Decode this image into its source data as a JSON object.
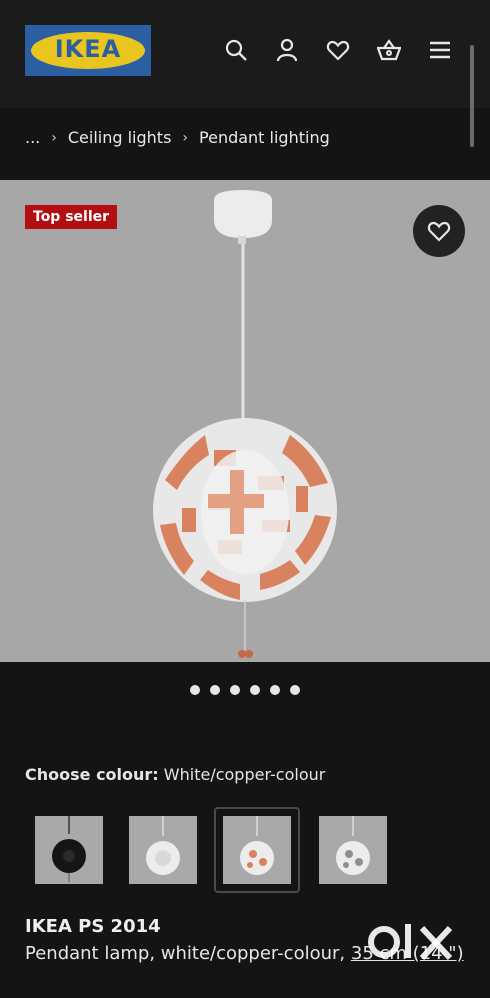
{
  "header": {
    "logo_text": "IKEA",
    "icons": [
      "search-icon",
      "user-icon",
      "heart-icon",
      "basket-icon",
      "menu-icon"
    ]
  },
  "breadcrumb": [
    "...",
    "Ceiling lights",
    "Pendant lighting"
  ],
  "gallery": {
    "badge": "Top seller",
    "dots_count": 6
  },
  "colour": {
    "label": "Choose colour:",
    "value": "White/copper-colour",
    "options": [
      "black",
      "white",
      "white/copper",
      "white/silver"
    ],
    "selected_index": 2
  },
  "product": {
    "name": "IKEA PS 2014",
    "description": "Pendant lamp, white/copper-colour,",
    "size": "35 cm (14 \")"
  },
  "colors": {
    "background": "#141414",
    "badge": "#b30f12",
    "logo_blue": "#2c5fa1",
    "logo_yellow": "#e8c51f",
    "copper": "#d9825f"
  }
}
